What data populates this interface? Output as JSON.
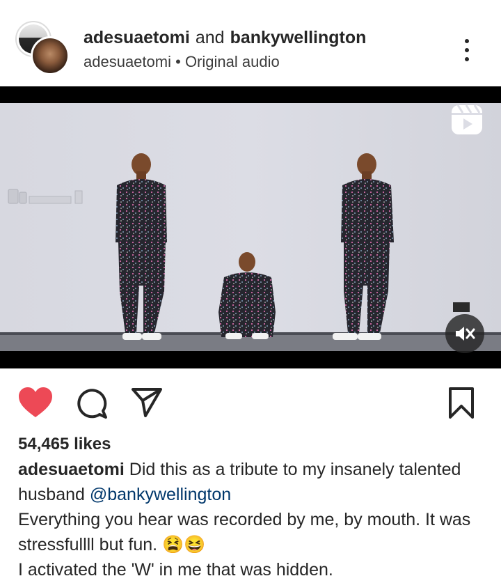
{
  "post": {
    "author_primary": "adesuaetomi",
    "connector": "and",
    "author_secondary": "bankywellington",
    "audio_owner": "adesuaetomi",
    "audio_separator": "•",
    "audio_label": "Original audio"
  },
  "icons": {
    "more": "more-vertical-icon",
    "reel": "reel-icon",
    "mute": "speaker-muted-icon",
    "like": "heart-filled-icon",
    "comment": "comment-icon",
    "share": "send-icon",
    "save": "bookmark-icon"
  },
  "colors": {
    "like": "#ed4956",
    "mention": "#00376b",
    "text": "#262626"
  },
  "stats": {
    "likes": "54,465 likes"
  },
  "caption": {
    "username": "adesuaetomi",
    "line1": "Did this as a tribute to my insanely talented husband ",
    "mention": "@bankywellington",
    "line2": "Everything you hear was recorded by me, by mouth. It was stressfullll but fun. 😫😆",
    "line3": "I activated the 'W' in me that was hidden."
  }
}
